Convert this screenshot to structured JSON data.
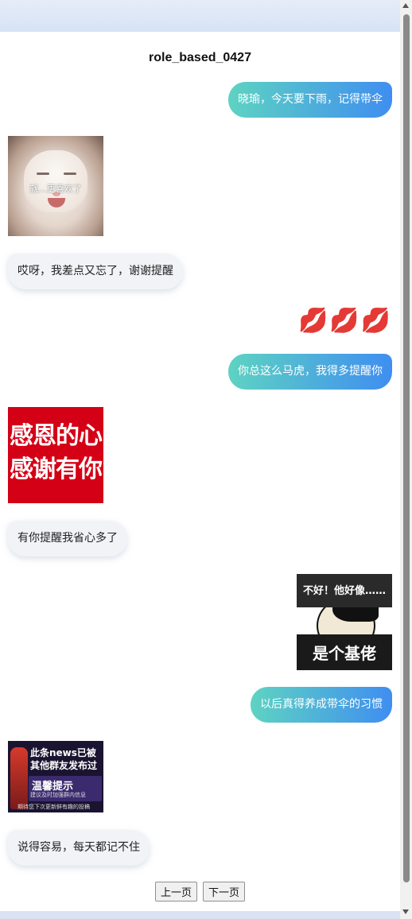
{
  "chat": {
    "title": "role_based_0427",
    "messages": [
      {
        "text": "晓瑜，今天要下雨，记得带伞"
      },
      {
        "caption": "就...更喜欢了"
      },
      {
        "text": "哎呀，我差点又忘了，谢谢提醒"
      },
      {
        "emoji": "💋💋💋"
      },
      {
        "text": "你总这么马虎，我得多提醒你"
      },
      {
        "line1": "感恩的心",
        "line2": "感谢有你"
      },
      {
        "text": "有你提醒我省心多了"
      },
      {
        "top": "不好！他好像……",
        "bottom": "是个基佬"
      },
      {
        "text": "以后真得养成带伞的习惯"
      },
      {
        "line1": "此条news已被",
        "line2": "其他群友发布过",
        "line3": "温馨提示",
        "line4": "建议及时加强群内信息",
        "line5": "期待您下次更新鲜有趣的投稿"
      },
      {
        "text": "说得容易，每天都记不住"
      }
    ]
  },
  "pager": {
    "prev_label": "上一页",
    "next_label": "下一页"
  }
}
